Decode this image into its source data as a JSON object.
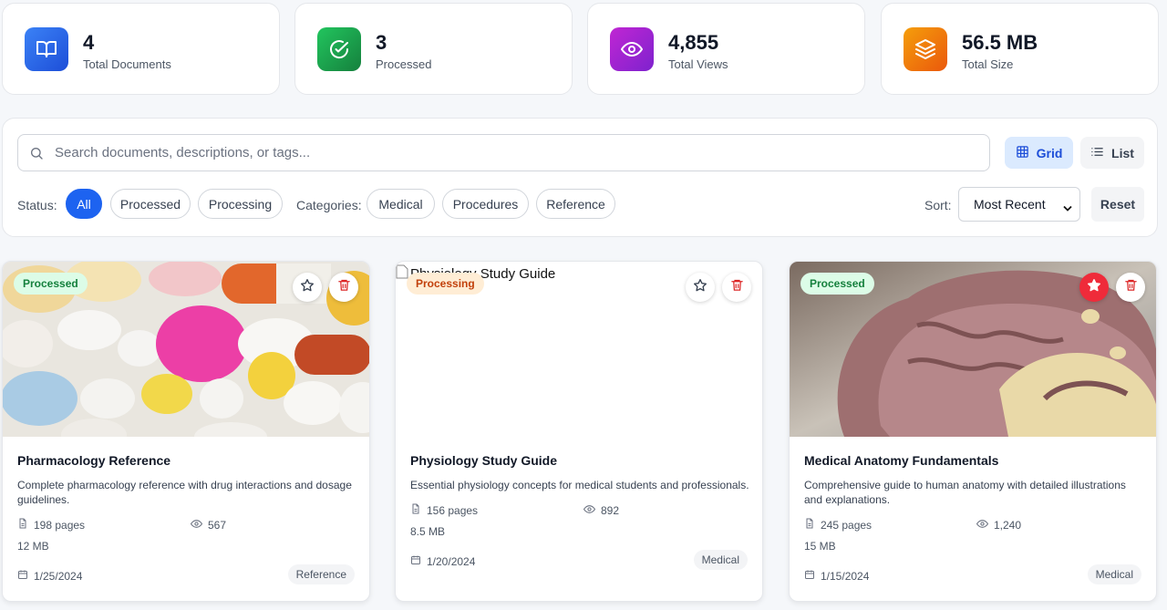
{
  "stats": [
    {
      "value": "4",
      "label": "Total Documents",
      "icon": "book-open-icon",
      "color": "#2563eb"
    },
    {
      "value": "3",
      "label": "Processed",
      "icon": "check-circle-icon",
      "color": "#16a34a"
    },
    {
      "value": "4,855",
      "label": "Total Views",
      "icon": "eye-icon",
      "color": "#a21caf"
    },
    {
      "value": "56.5 MB",
      "label": "Total Size",
      "icon": "layers-icon",
      "color": "#ea580c"
    }
  ],
  "search": {
    "placeholder": "Search documents, descriptions, or tags..."
  },
  "view": {
    "grid_label": "Grid",
    "list_label": "List",
    "active": "Grid"
  },
  "filters": {
    "status_label": "Status:",
    "status": [
      "All",
      "Processed",
      "Processing"
    ],
    "active_status": "All",
    "categories_label": "Categories:",
    "categories": [
      "Medical",
      "Procedures",
      "Reference"
    ],
    "sort_label": "Sort:",
    "sort_value": "Most Recent",
    "reset_label": "Reset"
  },
  "documents": [
    {
      "title": "Pharmacology Reference",
      "description": "Complete pharmacology reference with drug interactions and dosage guidelines.",
      "status": "Processed",
      "pages": "198 pages",
      "views": "567",
      "size": "12 MB",
      "date": "1/25/2024",
      "tag": "Reference",
      "favorite": false,
      "image": "pills-photo"
    },
    {
      "title": "Physiology Study Guide",
      "description": "Essential physiology concepts for medical students and professionals.",
      "status": "Processing",
      "pages": "156 pages",
      "views": "892",
      "size": "8.5 MB",
      "date": "1/20/2024",
      "tag": "Medical",
      "favorite": false,
      "image_alt": "Physiology Study Guide"
    },
    {
      "title": "Medical Anatomy Fundamentals",
      "description": "Comprehensive guide to human anatomy with detailed illustrations and explanations.",
      "status": "Processed",
      "pages": "245 pages",
      "views": "1,240",
      "size": "15 MB",
      "date": "1/15/2024",
      "tag": "Medical",
      "favorite": true,
      "image": "brain-model-photo"
    }
  ]
}
